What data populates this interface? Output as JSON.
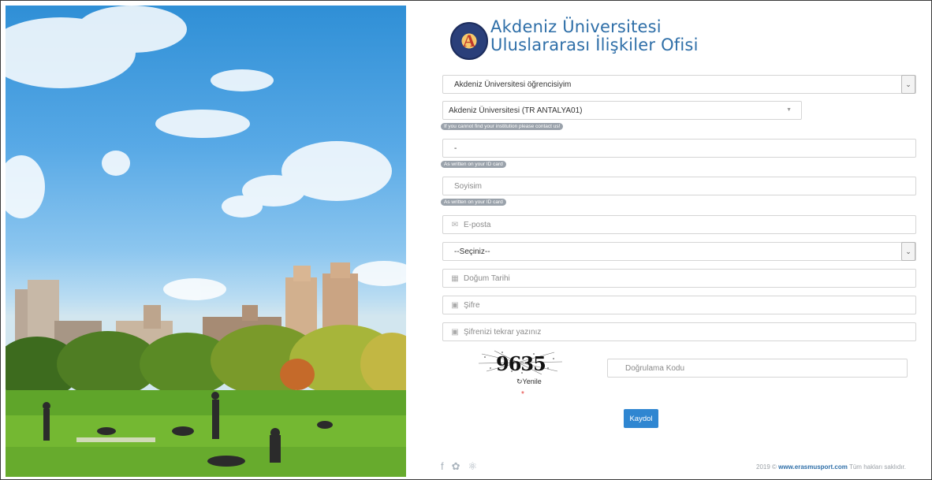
{
  "header": {
    "logo_text": "A",
    "title_line1": "Akdeniz Üniversitesi",
    "title_line2": "Uluslararası İlişkiler Ofisi"
  },
  "form": {
    "student_type": {
      "value": "Akdeniz Üniversitesi öğrencisiyim"
    },
    "institution": {
      "value": "Akdeniz Üniversitesi (TR ANTALYA01)",
      "hint": "If you cannot find your institution please contact us!"
    },
    "first_name": {
      "value": "-",
      "hint": "As written on your ID card"
    },
    "last_name": {
      "placeholder": "Soyisim",
      "hint": "As written on your ID card"
    },
    "email": {
      "placeholder": "E-posta",
      "icon": "envelope-icon"
    },
    "select": {
      "value": "--Seçiniz--"
    },
    "birth_date": {
      "placeholder": "Doğum Tarihi",
      "icon": "calendar-icon"
    },
    "password": {
      "placeholder": "Şifre",
      "icon": "lock-icon"
    },
    "password_repeat": {
      "placeholder": "Şifrenizi tekrar yazınız",
      "icon": "lock-icon"
    },
    "captcha": {
      "image_text": "9635",
      "refresh_label": "Yenile",
      "required_mark": "*",
      "input_placeholder": "Doğrulama Kodu"
    },
    "submit_label": "Kaydol"
  },
  "footer": {
    "socials": [
      "facebook-icon",
      "twitter-icon",
      "dribbble-icon"
    ],
    "copyright_prefix": "2019 ©",
    "copyright_link": "www.erasmusport.com",
    "copyright_suffix": "Tüm hakları saklıdır."
  },
  "colors": {
    "accent": "#2f86d1",
    "title": "#2f6fa8",
    "hint_badge": "#9aa2ab"
  }
}
